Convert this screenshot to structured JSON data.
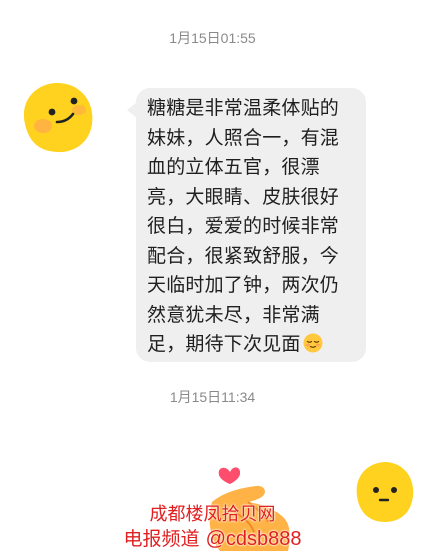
{
  "chat": {
    "timestamp_1": "1月15日01:55",
    "message_1": "糖糖是非常温柔体贴的妹妹，人照合一，有混血的立体五官，很漂亮，大眼睛、皮肤很好很白，爱爱的时候非常配合，很紧致舒服，今天临时加了钟，两次仍然意犹未尽，非常满足，期待下次见面",
    "message_1_emoji": "relieved-face-icon",
    "timestamp_2": "1月15日11:34"
  },
  "avatars": {
    "left": "yellow-blob-avatar-icon",
    "right": "yellow-blob-avatar-icon"
  },
  "sticker": {
    "icon": "finger-heart-hand-icon"
  },
  "watermark": {
    "line_1": "成都楼凤拾贝网",
    "line_2_prefix": "电报频道 ",
    "line_2_handle": "@cdsb888"
  },
  "colors": {
    "bubble": "#efefef",
    "avatar_yellow": "#ffd21f",
    "watermark_red": "#e02020",
    "timestamp": "#8a8a8a"
  }
}
